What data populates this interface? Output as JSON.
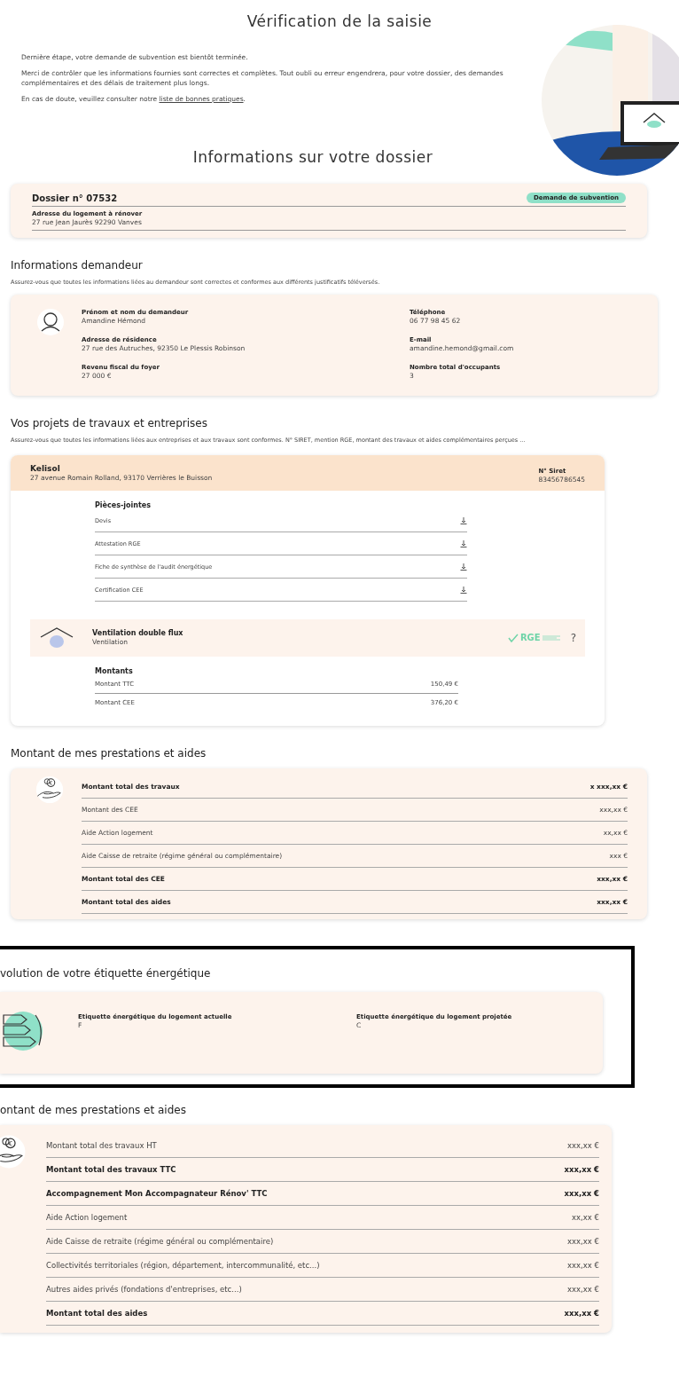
{
  "page_title": "Vérification de la saisie",
  "intro": {
    "lines": [
      "Dernière étape, votre demande de subvention est bientôt terminée.",
      "Merci de contrôler que les informations fournies sont correctes et complètes. Tout oubli ou erreur engendrera, pour votre dossier, des demandes complémentaires et des délais de traitement plus longs."
    ],
    "link_before": "En cas de doute, veuillez consulter notre ",
    "link": "liste de bonnes pratiques",
    "link_after": "."
  },
  "dossier_title": "Informations sur votre dossier",
  "dossier": {
    "number": "Dossier n° 07532",
    "badge": "Demande de subvention",
    "address_label": "Adresse du logement à rénover",
    "address": "27 rue Jean Jaurès 92290 Vanves"
  },
  "applicant": {
    "title": "Informations demandeur",
    "description": "Assurez-vous que toutes les informations liées au demandeur sont correctes et conformes aux différents justificatifs téléversés.",
    "fields": [
      {
        "label": "Prénom et nom du demandeur",
        "value": "Amandine Hémond"
      },
      {
        "label": "Téléphone",
        "value": "06 77 98 45 62"
      },
      {
        "label": "Adresse de résidence",
        "value": "27 rue des Autruches, 92350 Le Plessis Robinson"
      },
      {
        "label": "E-mail",
        "value": "amandine.hemond@gmail.com"
      },
      {
        "label": "Revenu fiscal du foyer",
        "value": "27 000 €"
      },
      {
        "label": "Nombre total d'occupants",
        "value": "3"
      }
    ]
  },
  "projects": {
    "title": "Vos projets de travaux et entreprises",
    "description": "Assurez-vous que toutes les informations liées aux entreprises et aux travaux sont conformes. N° SIRET, mention RGE, montant des travaux et aides complémentaires perçues ...",
    "company": {
      "name": "Kelisol",
      "address": "27 avenue Romain Rolland, 93170 Verrières le Buisson",
      "siret_label": "N° Siret",
      "siret": "83456786545"
    },
    "attachments": {
      "title": "Pièces-jointes",
      "items": [
        "Devis",
        "Attestation RGE",
        "Fiche de synthèse de l'audit énergétique",
        "Certification CEE"
      ]
    },
    "work": {
      "name": "Ventilation double flux",
      "category": "Ventilation",
      "label": "RGE",
      "help": "?"
    },
    "amounts": {
      "title": "Montants",
      "rows": [
        {
          "label": "Montant TTC",
          "value": "150,49 €"
        },
        {
          "label": "Montant CEE",
          "value": "376,20 €"
        }
      ]
    }
  },
  "benefits": {
    "title": "Montant de mes prestations et aides",
    "rows": [
      {
        "label": "Montant total des travaux",
        "value": "x xxx,xx €",
        "kind": "total"
      },
      {
        "label": "Montant des CEE",
        "value": "xxx,xx €",
        "kind": "line"
      },
      {
        "label": "Aide Action logement",
        "value": "xx,xx €",
        "kind": "line"
      },
      {
        "label": "Aide Caisse de retraite (régime général ou complémentaire)",
        "value": "xxx €",
        "kind": "line"
      },
      {
        "label": "Montant total des CEE",
        "value": "xxx,xx €",
        "kind": "total"
      },
      {
        "label": "Montant total des aides",
        "value": "xxx,xx €",
        "kind": "total"
      }
    ]
  },
  "energy": {
    "title": "volution de votre étiquette énergétique",
    "items": [
      {
        "label": "Etiquette énergétique du logement actuelle",
        "value": "F"
      },
      {
        "label": "Etiquette énergétique du logement projetée",
        "value": "C"
      }
    ]
  },
  "benefits_2": {
    "title": "ontant de mes prestations et aides",
    "rows": [
      {
        "label": "Montant total des travaux HT",
        "value": "xxx,xx €",
        "kind": "line"
      },
      {
        "label": "Montant total des travaux TTC",
        "value": "xxx,xx €",
        "kind": "total"
      },
      {
        "label": "Accompagnement Mon Accompagnateur Rénov' TTC",
        "value": "xxx,xx €",
        "kind": "total"
      },
      {
        "label": "Aide Action logement",
        "value": "xx,xx €",
        "kind": "line"
      },
      {
        "label": "Aide Caisse de retraite (régime général ou complémentaire)",
        "value": "xxx,xx €",
        "kind": "line"
      },
      {
        "label": "Collectivités territoriales (région, département, intercommunalité, etc...)",
        "value": "xxx,xx €",
        "kind": "line"
      },
      {
        "label": "Autres aides privés (fondations d'entreprises, etc...)",
        "value": "xxx,xx €",
        "kind": "line"
      },
      {
        "label": "Montant total des aides",
        "value": "xxx,xx €",
        "kind": "total"
      }
    ]
  }
}
